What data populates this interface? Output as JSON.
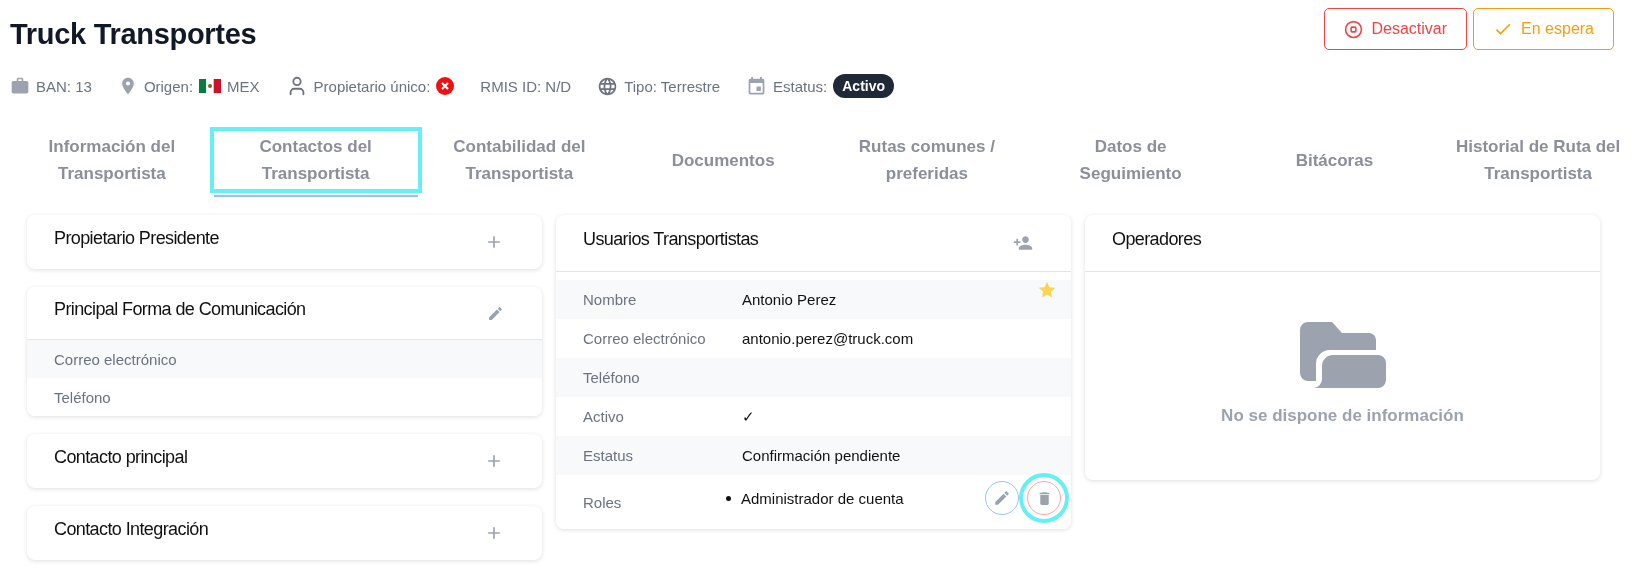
{
  "header": {
    "title": "Truck Transportes",
    "actions": [
      {
        "label": "Desactivar",
        "kind": "deactivate"
      },
      {
        "label": "En espera",
        "kind": "hold"
      }
    ]
  },
  "meta": [
    {
      "kind": "ban",
      "label": "BAN: 13"
    },
    {
      "kind": "origin",
      "label": "Origen:",
      "value": "MEX"
    },
    {
      "kind": "owner",
      "label": "Propietario único:",
      "checked": false
    },
    {
      "kind": "plain",
      "label": "RMIS ID: N/D"
    },
    {
      "kind": "type",
      "label": "Tipo: Terrestre"
    },
    {
      "kind": "status",
      "label": "Estatus:",
      "badge": "Activo"
    }
  ],
  "tabs": [
    {
      "label": "Información del Transportista",
      "selected": false,
      "highlighted": false
    },
    {
      "label": "Contactos del Transportista",
      "selected": true,
      "highlighted": true
    },
    {
      "label": "Contabilidad del Transportista",
      "selected": false,
      "highlighted": false
    },
    {
      "label": "Documentos",
      "selected": false,
      "highlighted": false
    },
    {
      "label": "Rutas comunes / preferidas",
      "selected": false,
      "highlighted": false
    },
    {
      "label": "Datos de Seguimiento",
      "selected": false,
      "highlighted": false
    },
    {
      "label": "Bitácoras",
      "selected": false,
      "highlighted": false
    },
    {
      "label": "Historial de Ruta del Transportista",
      "selected": false,
      "highlighted": false
    }
  ],
  "contact_cards": [
    {
      "title": "Propietario Presidente",
      "kind": "add"
    },
    {
      "title": "Principal Forma de Comunicación",
      "kind": "edit",
      "items": [
        "Correo electrónico",
        "Teléfono"
      ]
    },
    {
      "title": "Contacto principal",
      "kind": "add"
    },
    {
      "title": "Contacto Integración",
      "kind": "add"
    }
  ],
  "users_card": {
    "title": "Usuarios Transportistas",
    "user": {
      "favorite": true,
      "fields": [
        {
          "label": "Nombre",
          "value": "Antonio Perez"
        },
        {
          "label": "Correo electrónico",
          "value": "antonio.perez@truck.com"
        },
        {
          "label": "Teléfono"
        },
        {
          "label": "Activo",
          "value": "✓"
        },
        {
          "label": "Estatus",
          "value": "Confirmación pendiente"
        },
        {
          "label": "Roles",
          "roles": [
            "Administrador de cuenta"
          ]
        }
      ],
      "delete_highlighted": true
    }
  },
  "operators_card": {
    "title": "Operadores",
    "empty_message": "No se dispone de información"
  }
}
